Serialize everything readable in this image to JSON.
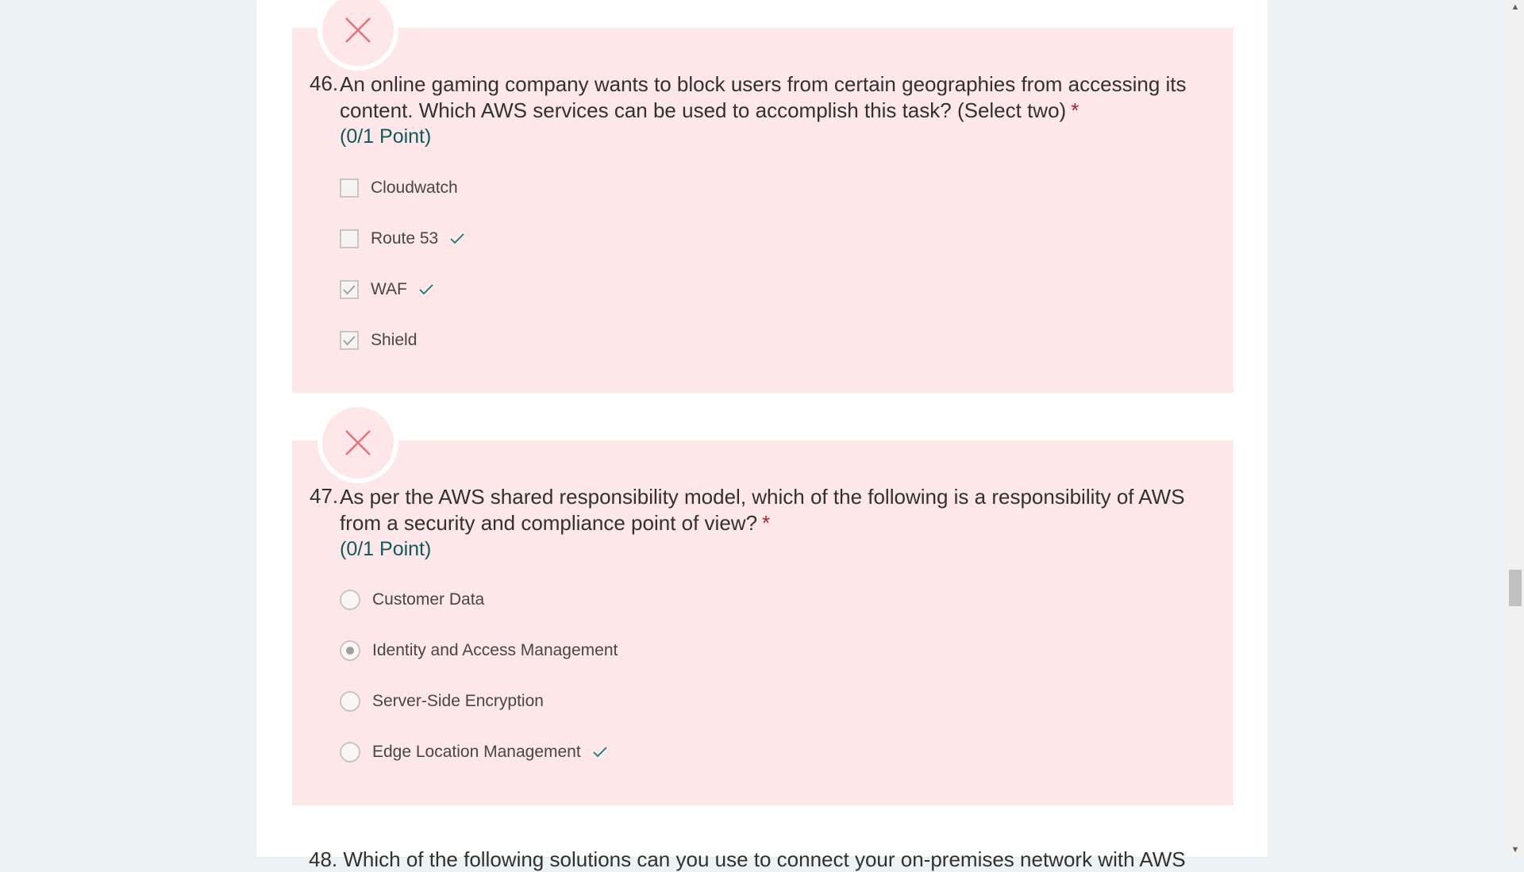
{
  "questions": [
    {
      "number": "46.",
      "title_line1": "An online gaming company wants to block users from certain geographies from accessing its",
      "title_line2": "content. Which AWS services can be used to accomplish this task? (Select two)",
      "required_marker": "*",
      "points": "(0/1 Point)",
      "type": "checkbox",
      "options": [
        {
          "label": "Cloudwatch",
          "checked": false,
          "correct": false
        },
        {
          "label": "Route 53",
          "checked": false,
          "correct": true
        },
        {
          "label": "WAF",
          "checked": true,
          "correct": true
        },
        {
          "label": "Shield",
          "checked": true,
          "correct": false
        }
      ]
    },
    {
      "number": "47.",
      "title_line1": "As per the AWS shared responsibility model, which of the following is a responsibility of AWS",
      "title_line2": "from a security and compliance point of view?",
      "required_marker": "*",
      "points": "(0/1 Point)",
      "type": "radio",
      "options": [
        {
          "label": "Customer Data",
          "selected": false,
          "correct": false
        },
        {
          "label": "Identity and Access Management",
          "selected": true,
          "correct": false
        },
        {
          "label": "Server-Side Encryption",
          "selected": false,
          "correct": false
        },
        {
          "label": "Edge Location Management",
          "selected": false,
          "correct": true
        }
      ]
    }
  ],
  "next_question_peek": "48. Which of the following solutions can you use to connect your on-premises network with AWS",
  "colors": {
    "background": "#edf3f4",
    "card": "#ffffff",
    "incorrect_bg": "#fde7e9",
    "incorrect_icon": "#e8707a",
    "correct_check": "#0f7c75",
    "points_text": "#0f5a5b",
    "required": "#a4262c"
  },
  "icons": {
    "incorrect": "close-x-icon",
    "correct": "checkmark-icon",
    "scroll_up": "chevron-up-icon",
    "scroll_down": "chevron-down-icon"
  }
}
